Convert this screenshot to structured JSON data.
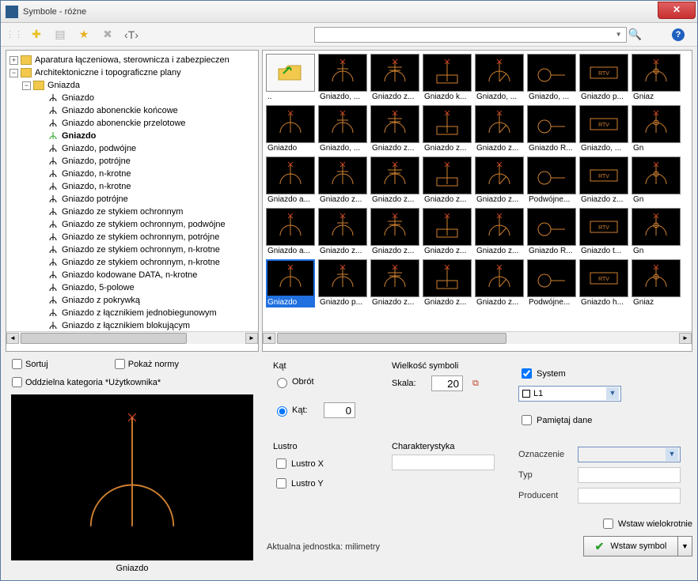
{
  "window": {
    "title": "Symbole - różne"
  },
  "toolbar": {
    "search_placeholder": ""
  },
  "tree": {
    "root1": "Aparatura łączeniowa, sterownicza i zabezpieczen",
    "root2": "Architektoniczne i topograficzne plany",
    "root3": "Gniazda",
    "items": [
      "Gniazdo",
      "Gniazdo abonenckie końcowe",
      "Gniazdo abonenckie przelotowe",
      "Gniazdo",
      "Gniazdo, podwójne",
      "Gniazdo, potrójne",
      "Gniazdo, n-krotne",
      "Gniazdo, n-krotne",
      "Gniazdo potrójne",
      "Gniazdo ze stykiem ochronnym",
      "Gniazdo ze stykiem ochronnym, podwójne",
      "Gniazdo ze stykiem ochronnym, potrójne",
      "Gniazdo ze stykiem ochronnym, n-krotne",
      "Gniazdo ze stykiem ochronnym, n-krotne",
      "Gniazdo kodowane DATA, n-krotne",
      "Gniazdo, 5-polowe",
      "Gniazdo z pokrywką",
      "Gniazdo z łącznikiem jednobiegunowym",
      "Gniazdo z łącznikiem blokującym"
    ]
  },
  "grid": {
    "up_label": "..",
    "rows": [
      [
        "..",
        "Gniazdo, ...",
        "Gniazdo z...",
        "Gniazdo k...",
        "Gniazdo, ...",
        "Gniazdo, ...",
        "Gniazdo p...",
        "Gniaz"
      ],
      [
        "Gniazdo",
        "Gniazdo, ...",
        "Gniazdo z...",
        "Gniazdo z...",
        "Gniazdo z...",
        "Gniazdo R...",
        "Gniazdo, ...",
        "Gn"
      ],
      [
        "Gniazdo a...",
        "Gniazdo z...",
        "Gniazdo z...",
        "Gniazdo z...",
        "Gniazdo z...",
        "Podwójne...",
        "Gniazdo z...",
        "Gn"
      ],
      [
        "Gniazdo a...",
        "Gniazdo z...",
        "Gniazdo z...",
        "Gniazdo z...",
        "Gniazdo z...",
        "Gniazdo R...",
        "Gniazdo t...",
        "Gn"
      ],
      [
        "Gniazdo",
        "Gniazdo p...",
        "Gniazdo z...",
        "Gniazdo z...",
        "Gniazdo z...",
        "Podwójne...",
        "Gniazdo h...",
        "Gniaz"
      ]
    ],
    "selected": {
      "row": 4,
      "col": 0
    }
  },
  "controls": {
    "sortuj": "Sortuj",
    "pokaz_normy": "Pokaż normy",
    "oddzielna_kat": "Oddzielna kategoria *Użytkownika*",
    "kat_group": "Kąt",
    "obrot": "Obrót",
    "kat": "Kąt:",
    "kat_value": "0",
    "lustro_group": "Lustro",
    "lustro_x": "Lustro X",
    "lustro_y": "Lustro Y",
    "wielkosc_group": "Wielkość symboli",
    "skala": "Skala:",
    "skala_value": "20",
    "charakterystyka": "Charakterystyka",
    "system": "System",
    "system_value": "L1",
    "pamietaj": "Pamiętaj dane",
    "oznaczenie": "Oznaczenie",
    "typ": "Typ",
    "producent": "Producent",
    "wstaw_wielo": "Wstaw wielokrotnie",
    "wstaw_symbol": "Wstaw symbol",
    "units": "Aktualna jednostka: milimetry"
  },
  "preview": {
    "label": "Gniazdo"
  }
}
